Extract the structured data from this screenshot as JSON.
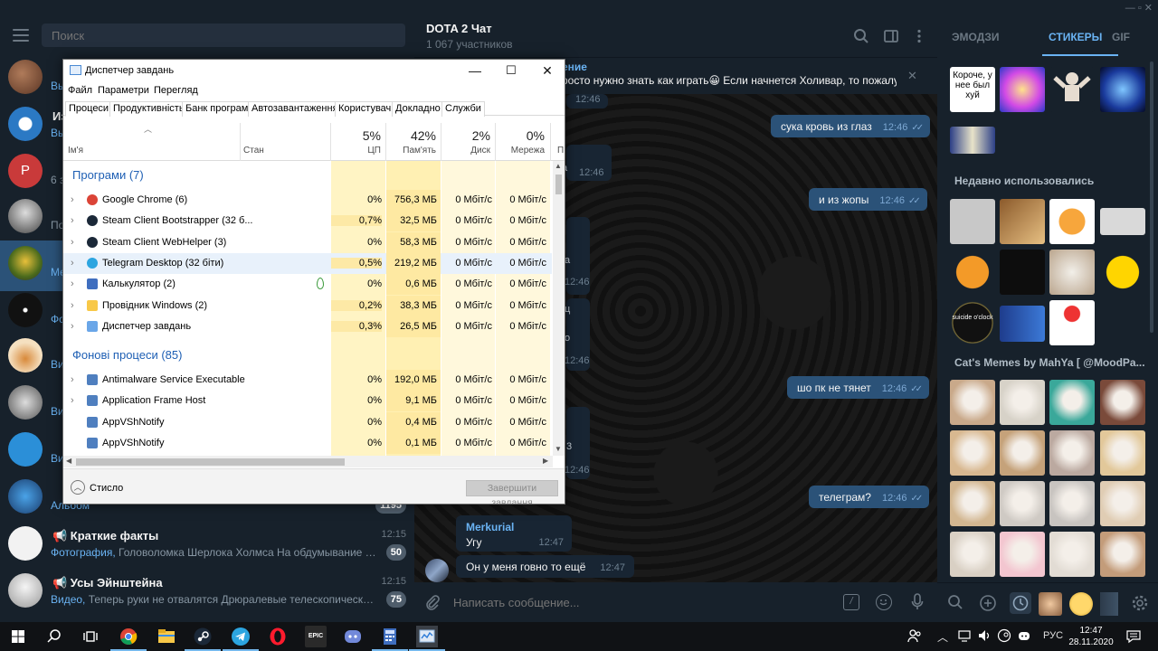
{
  "telegram": {
    "search_placeholder": "Поиск",
    "chats": [
      {
        "title": "",
        "preview": "Вы",
        "time": ""
      },
      {
        "title": "Из",
        "preview": "Вы",
        "time": ""
      },
      {
        "title": "",
        "preview": "6 з",
        "time": ""
      },
      {
        "title": "",
        "preview": "По",
        "time": ""
      },
      {
        "title": "",
        "preview": "Ме",
        "time": ""
      },
      {
        "title": "",
        "preview": "Фо",
        "time": ""
      },
      {
        "title": "",
        "preview": "Ви",
        "time": ""
      },
      {
        "title": "",
        "preview": "Ви",
        "time": ""
      },
      {
        "title": "",
        "preview": "Ви",
        "time": ""
      },
      {
        "title": "",
        "preview": "Альбом",
        "time": "",
        "badge": "1195"
      },
      {
        "title": "Краткие факты",
        "kind": "Фотография,",
        "preview": " Головоломка Шерлока Холмса  На обдумывание и реш...",
        "time": "12:15",
        "badge": "50"
      },
      {
        "title": "Усы Эйнштейна",
        "kind": "Видео,",
        "preview": " Теперь руки не отвалятся  Дрюралевые телескопические под...",
        "time": "12:15",
        "badge": "75"
      }
    ],
    "chat": {
      "title": "DOTA 2 Чат",
      "subtitle": "1 067 участников",
      "pinned_author": "ение",
      "pinned_text": "росто нужно знать как играть😀  Если начнется Холивар, то пожалу...",
      "messages": [
        {
          "dir": "out",
          "text": "сука кровь из глаз",
          "time": "12:46"
        },
        {
          "dir": "out",
          "text": "и из жопы",
          "time": "12:46"
        },
        {
          "dir": "out",
          "text": "шо пк не тянет",
          "time": "12:46"
        },
        {
          "dir": "out",
          "text": "телеграм?",
          "time": "12:46"
        },
        {
          "dir": "in",
          "author": "Merkurial",
          "text": "Угу",
          "time": "12:47"
        },
        {
          "dir": "in",
          "text": "Он у меня говно то ещё",
          "time": "12:47"
        }
      ],
      "partial_times": [
        "12:46",
        "12:46",
        "12:46",
        "12:46",
        "12:46",
        "12:46",
        "12:46"
      ],
      "partial_texts": [
        "а",
        "а",
        "ц",
        "о",
        "3"
      ],
      "composer_placeholder": "Написать сообщение..."
    },
    "right_panel": {
      "tabs": [
        "ЭМОДЗИ",
        "СТИКЕРЫ",
        "GIF"
      ],
      "active_tab": "СТИКЕРЫ",
      "sticker_caption": "Короче, у нее был хуй",
      "sticker_caption_2": "suicide o'clock",
      "sections": [
        "Недавно использовались",
        "Cat's Memes by MahYa [ @MoodPa..."
      ],
      "window_controls": "— ▫ ✕"
    }
  },
  "taskmgr": {
    "title": "Диспетчер завдань",
    "menu": [
      "Файл",
      "Параметри",
      "Перегляд"
    ],
    "tabs": [
      "Процеси",
      "Продуктивність",
      "Банк програм",
      "Автозавантаження",
      "Користувачі",
      "Докладно",
      "Служби"
    ],
    "active_tab": "Процеси",
    "columns": {
      "name": "Ім'я",
      "status": "Стан",
      "cpu": {
        "pct": "5%",
        "label": "ЦП"
      },
      "memory": {
        "pct": "42%",
        "label": "Пам'ять"
      },
      "disk": {
        "pct": "2%",
        "label": "Диск"
      },
      "network": {
        "pct": "0%",
        "label": "Мережа"
      },
      "extra": "П"
    },
    "groups": [
      {
        "title": "Програми (7)",
        "rows": [
          {
            "name": "Google Chrome (6)",
            "cpu": "0%",
            "mem": "756,3 МБ",
            "disk": "0 Мбіт/с",
            "net": "0 Мбіт/с",
            "icon": "chrome-icon"
          },
          {
            "name": "Steam Client Bootstrapper (32 б...",
            "cpu": "0,7%",
            "mem": "32,5 МБ",
            "disk": "0 Мбіт/с",
            "net": "0 Мбіт/с",
            "icon": "steam-icon"
          },
          {
            "name": "Steam Client WebHelper (3)",
            "cpu": "0%",
            "mem": "58,3 МБ",
            "disk": "0 Мбіт/с",
            "net": "0 Мбіт/с",
            "icon": "steam-icon"
          },
          {
            "name": "Telegram Desktop (32 біти)",
            "cpu": "0,5%",
            "mem": "219,2 МБ",
            "disk": "0 Мбіт/с",
            "net": "0 Мбіт/с",
            "icon": "telegram-icon"
          },
          {
            "name": "Калькулятор (2)",
            "cpu": "0%",
            "mem": "0,6 МБ",
            "disk": "0 Мбіт/с",
            "net": "0 Мбіт/с",
            "icon": "calculator-icon"
          },
          {
            "name": "Провідник Windows (2)",
            "cpu": "0,2%",
            "mem": "38,3 МБ",
            "disk": "0 Мбіт/с",
            "net": "0 Мбіт/с",
            "icon": "explorer-icon"
          },
          {
            "name": "Диспетчер завдань",
            "cpu": "0,3%",
            "mem": "26,5 МБ",
            "disk": "0 Мбіт/с",
            "net": "0 Мбіт/с",
            "icon": "taskmgr-icon"
          }
        ]
      },
      {
        "title": "Фонові процеси (85)",
        "rows": [
          {
            "name": "Antimalware Service Executable",
            "cpu": "0%",
            "mem": "192,0 МБ",
            "disk": "0 Мбіт/с",
            "net": "0 Мбіт/с",
            "icon": "service-icon"
          },
          {
            "name": "Application Frame Host",
            "cpu": "0%",
            "mem": "9,1 МБ",
            "disk": "0 Мбіт/с",
            "net": "0 Мбіт/с",
            "icon": "service-icon"
          },
          {
            "name": "AppVShNotify",
            "cpu": "0%",
            "mem": "0,4 МБ",
            "disk": "0 Мбіт/с",
            "net": "0 Мбіт/с",
            "icon": "service-icon"
          },
          {
            "name": "AppVShNotify",
            "cpu": "0%",
            "mem": "0,1 МБ",
            "disk": "0 Мбіт/с",
            "net": "0 Мбіт/с",
            "icon": "service-icon"
          }
        ]
      }
    ],
    "footer": {
      "collapse_label": "Стисло",
      "end_task_label": "Завершити завдання"
    }
  },
  "taskbar": {
    "apps": [
      "windows-start-icon",
      "search-icon",
      "task-view-icon",
      "chrome-icon",
      "explorer-icon",
      "steam-icon",
      "telegram-icon",
      "opera-icon",
      "epic-games-icon",
      "discord-icon",
      "calculator-icon",
      "taskmgr-icon"
    ],
    "epic_label": "EPIC",
    "language": "РУС",
    "time": "12:47",
    "date": "28.11.2020"
  },
  "colors": {
    "telegram_bg": "#17212b",
    "outgoing_bubble": "#2b5278",
    "accent": "#6ab3f3",
    "taskmgr_group": "#1e5fb4",
    "cpu_fill": "#fff4c4"
  }
}
